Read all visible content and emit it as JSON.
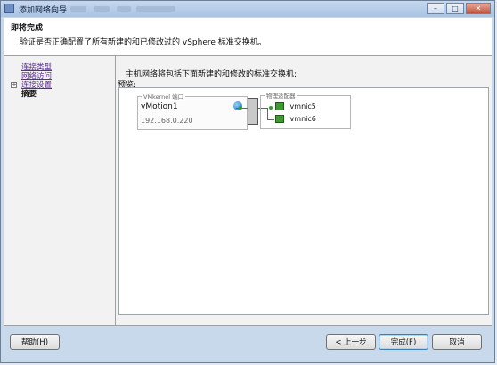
{
  "window": {
    "title": "添加网络向导",
    "controls": {
      "minimize": "–",
      "maximize": "□",
      "close": "✕"
    }
  },
  "header": {
    "title": "即将完成",
    "subtitle": "验证是否正确配置了所有新建的和已修改过的 vSphere 标准交换机。"
  },
  "nav": {
    "items": [
      {
        "label": "连接类型",
        "style": "link"
      },
      {
        "label": "网络访问",
        "style": "link"
      },
      {
        "label": "连接设置",
        "style": "link",
        "expandable": true,
        "expander": "+"
      },
      {
        "label": "摘要",
        "style": "bold"
      }
    ]
  },
  "main": {
    "description": "主机网络将包括下面新建的和修改的标准交换机:",
    "preview_label": "预览:"
  },
  "preview": {
    "port_group_caption": "VMkernel 端口",
    "port_name": "vMotion1",
    "port_ip": "192.168.0.220",
    "adapters_caption": "物理适配器",
    "adapters": [
      "vmnic5",
      "vmnic6"
    ]
  },
  "footer": {
    "help_label": "帮助(H)",
    "back_label": "< 上一步",
    "finish_label": "完成(F)",
    "cancel_label": "取消"
  },
  "icons": {
    "app": "wizard-icon",
    "port": "globe-icon",
    "nic": "network-card-icon",
    "expander": "plus-box-icon"
  },
  "colors": {
    "link": "#5a2a9c",
    "nic": "#3b9b2e",
    "status_dot": "#2ea12e",
    "title_bar": "#c6d8ee"
  }
}
